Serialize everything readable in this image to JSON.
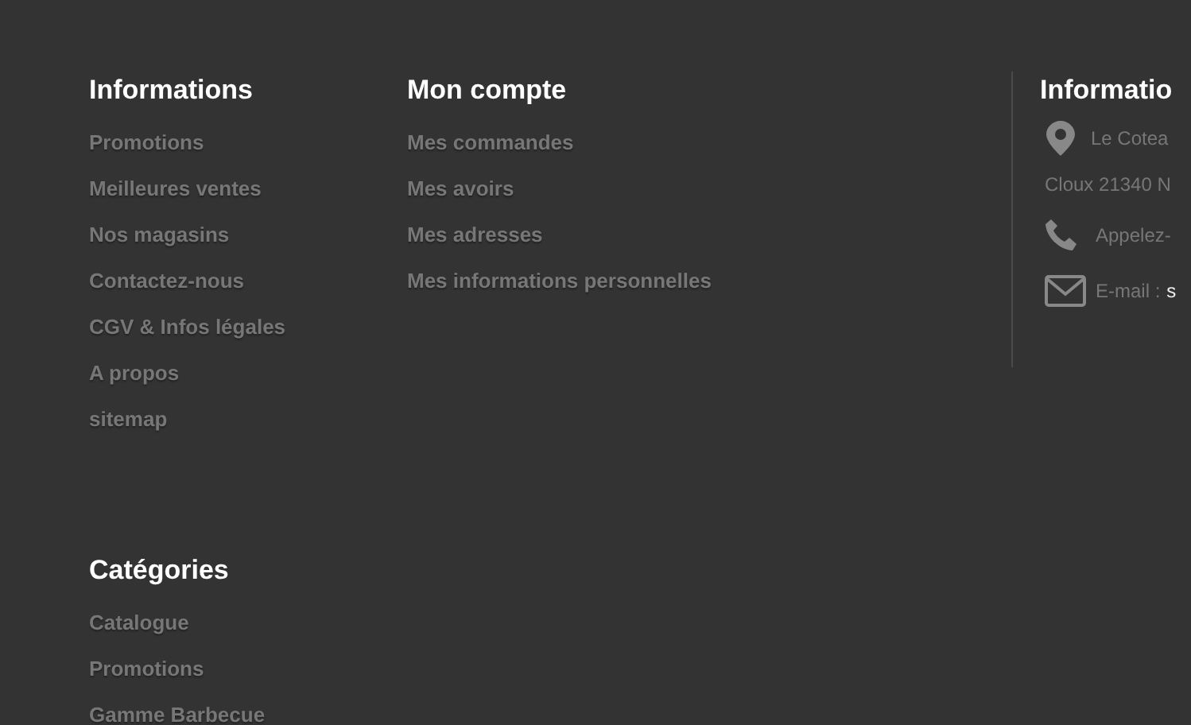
{
  "columns": [
    {
      "title": "Informations",
      "links": [
        "Promotions",
        "Meilleures ventes",
        "Nos magasins",
        "Contactez-nous",
        "CGV & Infos légales",
        "A propos",
        "sitemap"
      ]
    },
    {
      "title": "Mon compte",
      "links": [
        "Mes commandes",
        "Mes avoirs",
        "Mes adresses",
        "Mes informations personnelles"
      ]
    }
  ],
  "contact": {
    "title": "Informatio",
    "address": [
      "Le Cotea",
      "Cloux 21340 N"
    ],
    "phone": "Appelez-",
    "email_label": "E-mail :",
    "email_value": "s"
  },
  "categories": {
    "title": "Catégories",
    "links": [
      "Catalogue",
      "Promotions",
      "Gamme Barbecue"
    ]
  }
}
